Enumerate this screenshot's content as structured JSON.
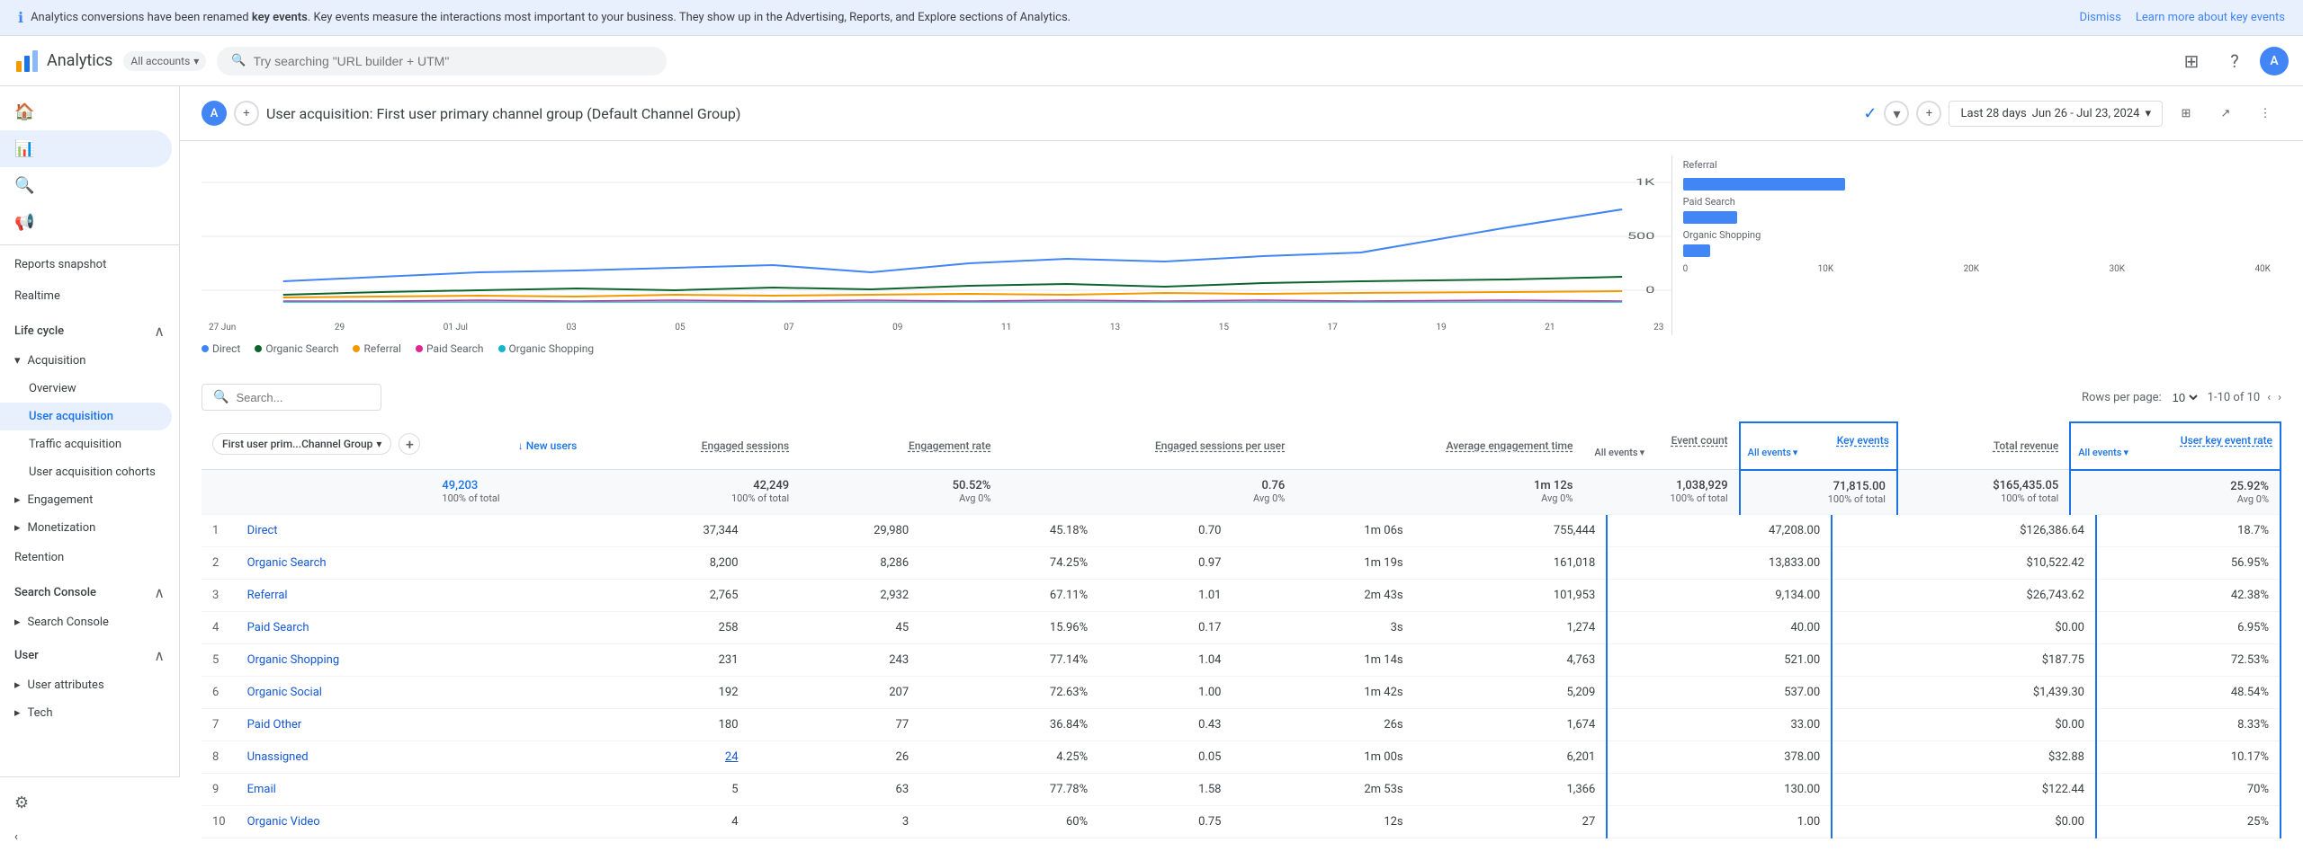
{
  "banner": {
    "text_pre": "Analytics conversions have been renamed ",
    "text_bold": "key events",
    "text_post": ". Key events measure the interactions most important to your business. They show up in the Advertising, Reports, and Explore sections of Analytics.",
    "dismiss": "Dismiss",
    "learn_more": "Learn more about key events"
  },
  "header": {
    "logo_text": "Analytics",
    "accounts_label": "All accounts",
    "search_placeholder": "Try searching \"URL builder + UTM\"",
    "avatar_letter": "A"
  },
  "sidebar": {
    "reports_snapshot": "Reports snapshot",
    "realtime": "Realtime",
    "life_cycle_label": "Life cycle",
    "acquisition_label": "Acquisition",
    "overview": "Overview",
    "user_acquisition": "User acquisition",
    "traffic_acquisition": "Traffic acquisition",
    "user_acquisition_cohorts": "User acquisition cohorts",
    "engagement": "Engagement",
    "monetization": "Monetization",
    "retention": "Retention",
    "search_console_group": "Search Console",
    "search_console_item": "Search Console",
    "user_group": "User",
    "user_attributes": "User attributes",
    "tech": "Tech",
    "settings_label": "Settings",
    "collapse_label": "Collapse"
  },
  "page": {
    "title": "User acquisition: First user primary channel group (Default Channel Group)",
    "date_label": "Last 28 days",
    "date_range": "Jun 26 - Jul 23, 2024"
  },
  "chart": {
    "legend": [
      {
        "label": "Direct",
        "color": "#4285f4"
      },
      {
        "label": "Organic Search",
        "color": "#0d652d"
      },
      {
        "label": "Referral",
        "color": "#f29900"
      },
      {
        "label": "Paid Search",
        "color": "#e52592"
      },
      {
        "label": "Organic Shopping",
        "color": "#12b5cb"
      }
    ],
    "x_labels": [
      "27 Jun",
      "29",
      "01 Jul",
      "03",
      "05",
      "07",
      "09",
      "11",
      "13",
      "15",
      "17",
      "19",
      "21",
      "23"
    ],
    "y_labels": [
      "1K",
      "500",
      "0"
    ],
    "bar_chart_labels": [
      "Referral",
      "Paid Search",
      "Organic Shopping"
    ],
    "bar_chart_x": [
      "0",
      "10K",
      "20K",
      "30K",
      "40K"
    ]
  },
  "table": {
    "search_placeholder": "Search...",
    "rows_per_page_label": "Rows per page:",
    "rows_per_page_value": "10",
    "pagination": "1-10 of 10",
    "dimension_label": "First user prim...Channel Group",
    "columns": [
      {
        "label": "↓ New users",
        "sublabel": ""
      },
      {
        "label": "Engaged sessions",
        "sublabel": ""
      },
      {
        "label": "Engagement rate",
        "sublabel": ""
      },
      {
        "label": "Engaged sessions per user",
        "sublabel": ""
      },
      {
        "label": "Average engagement time",
        "sublabel": ""
      },
      {
        "label": "Event count",
        "sublabel": "All events"
      },
      {
        "label": "Key events",
        "sublabel": "All events",
        "highlighted": true
      },
      {
        "label": "Total revenue",
        "sublabel": ""
      },
      {
        "label": "User key event rate",
        "sublabel": "All events",
        "highlighted": true
      }
    ],
    "totals": {
      "new_users": "49,203",
      "new_users_sub": "100% of total",
      "engaged_sessions": "42,249",
      "engaged_sessions_sub": "100% of total",
      "engagement_rate": "50.52%",
      "engagement_rate_sub": "Avg 0%",
      "engaged_per_user": "0.76",
      "engaged_per_user_sub": "Avg 0%",
      "avg_engagement": "1m 12s",
      "avg_engagement_sub": "Avg 0%",
      "event_count": "1,038,929",
      "event_count_sub": "100% of total",
      "key_events": "71,815.00",
      "key_events_sub": "100% of total",
      "total_revenue": "$165,435.05",
      "total_revenue_sub": "100% of total",
      "user_key_event_rate": "25.92%",
      "user_key_event_rate_sub": "Avg 0%"
    },
    "rows": [
      {
        "rank": "1",
        "channel": "Direct",
        "new_users": "37,344",
        "engaged_sessions": "29,980",
        "engagement_rate": "45.18%",
        "engaged_per_user": "0.70",
        "avg_engagement": "1m 06s",
        "event_count": "755,444",
        "key_events": "47,208.00",
        "total_revenue": "$126,386.64",
        "user_key_event_rate": "18.7%"
      },
      {
        "rank": "2",
        "channel": "Organic Search",
        "new_users": "8,200",
        "engaged_sessions": "8,286",
        "engagement_rate": "74.25%",
        "engaged_per_user": "0.97",
        "avg_engagement": "1m 19s",
        "event_count": "161,018",
        "key_events": "13,833.00",
        "total_revenue": "$10,522.42",
        "user_key_event_rate": "56.95%"
      },
      {
        "rank": "3",
        "channel": "Referral",
        "new_users": "2,765",
        "engaged_sessions": "2,932",
        "engagement_rate": "67.11%",
        "engaged_per_user": "1.01",
        "avg_engagement": "2m 43s",
        "event_count": "101,953",
        "key_events": "9,134.00",
        "total_revenue": "$26,743.62",
        "user_key_event_rate": "42.38%"
      },
      {
        "rank": "4",
        "channel": "Paid Search",
        "new_users": "258",
        "engaged_sessions": "45",
        "engagement_rate": "15.96%",
        "engaged_per_user": "0.17",
        "avg_engagement": "3s",
        "event_count": "1,274",
        "key_events": "40.00",
        "total_revenue": "$0.00",
        "user_key_event_rate": "6.95%"
      },
      {
        "rank": "5",
        "channel": "Organic Shopping",
        "new_users": "231",
        "engaged_sessions": "243",
        "engagement_rate": "77.14%",
        "engaged_per_user": "1.04",
        "avg_engagement": "1m 14s",
        "event_count": "4,763",
        "key_events": "521.00",
        "total_revenue": "$187.75",
        "user_key_event_rate": "72.53%"
      },
      {
        "rank": "6",
        "channel": "Organic Social",
        "new_users": "192",
        "engaged_sessions": "207",
        "engagement_rate": "72.63%",
        "engaged_per_user": "1.00",
        "avg_engagement": "1m 42s",
        "event_count": "5,209",
        "key_events": "537.00",
        "total_revenue": "$1,439.30",
        "user_key_event_rate": "48.54%"
      },
      {
        "rank": "7",
        "channel": "Paid Other",
        "new_users": "180",
        "engaged_sessions": "77",
        "engagement_rate": "36.84%",
        "engaged_per_user": "0.43",
        "avg_engagement": "26s",
        "event_count": "1,674",
        "key_events": "33.00",
        "total_revenue": "$0.00",
        "user_key_event_rate": "8.33%"
      },
      {
        "rank": "8",
        "channel": "Unassigned",
        "new_users": "24",
        "engaged_sessions": "26",
        "engagement_rate": "4.25%",
        "engaged_per_user": "0.05",
        "avg_engagement": "1m 00s",
        "event_count": "6,201",
        "key_events": "378.00",
        "total_revenue": "$32.88",
        "user_key_event_rate": "10.17%",
        "new_users_link": true
      },
      {
        "rank": "9",
        "channel": "Email",
        "new_users": "5",
        "engaged_sessions": "63",
        "engagement_rate": "77.78%",
        "engaged_per_user": "1.58",
        "avg_engagement": "2m 53s",
        "event_count": "1,366",
        "key_events": "130.00",
        "total_revenue": "$122.44",
        "user_key_event_rate": "70%"
      },
      {
        "rank": "10",
        "channel": "Organic Video",
        "new_users": "4",
        "engaged_sessions": "3",
        "engagement_rate": "60%",
        "engaged_per_user": "0.75",
        "avg_engagement": "12s",
        "event_count": "27",
        "key_events": "1.00",
        "total_revenue": "$0.00",
        "user_key_event_rate": "25%"
      }
    ]
  },
  "colors": {
    "accent": "#1a73e8",
    "border": "#dadce0",
    "highlight": "#1a73e8",
    "row_hover": "#f8f9fa"
  }
}
